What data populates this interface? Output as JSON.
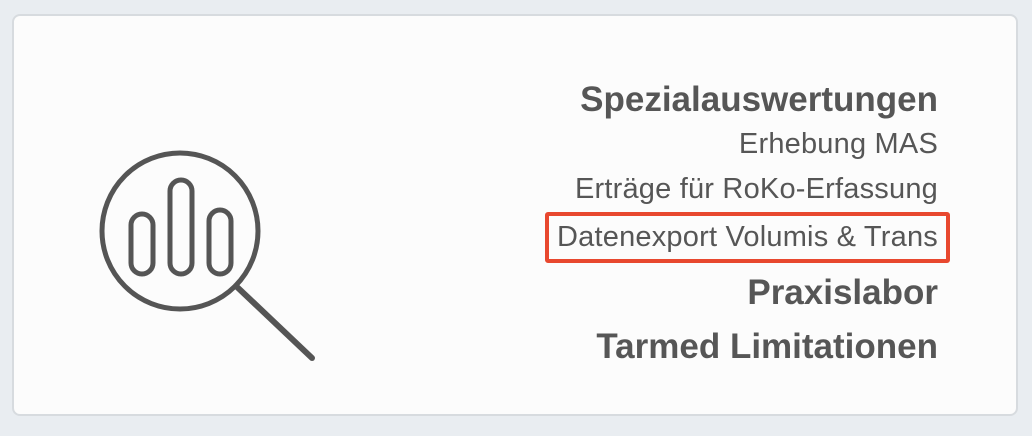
{
  "menu": {
    "title": "Spezialauswertungen",
    "items": [
      "Erhebung MAS",
      "Erträge für RoKo-Erfassung",
      "Datenexport Volumis & Trans"
    ],
    "praxislabor": "Praxislabor",
    "tarmed": "Tarmed Limitationen"
  },
  "colors": {
    "highlight": "#e8482f",
    "text": "#565656",
    "icon": "#555555"
  },
  "icons": {
    "main": "magnifier-chart-icon"
  }
}
